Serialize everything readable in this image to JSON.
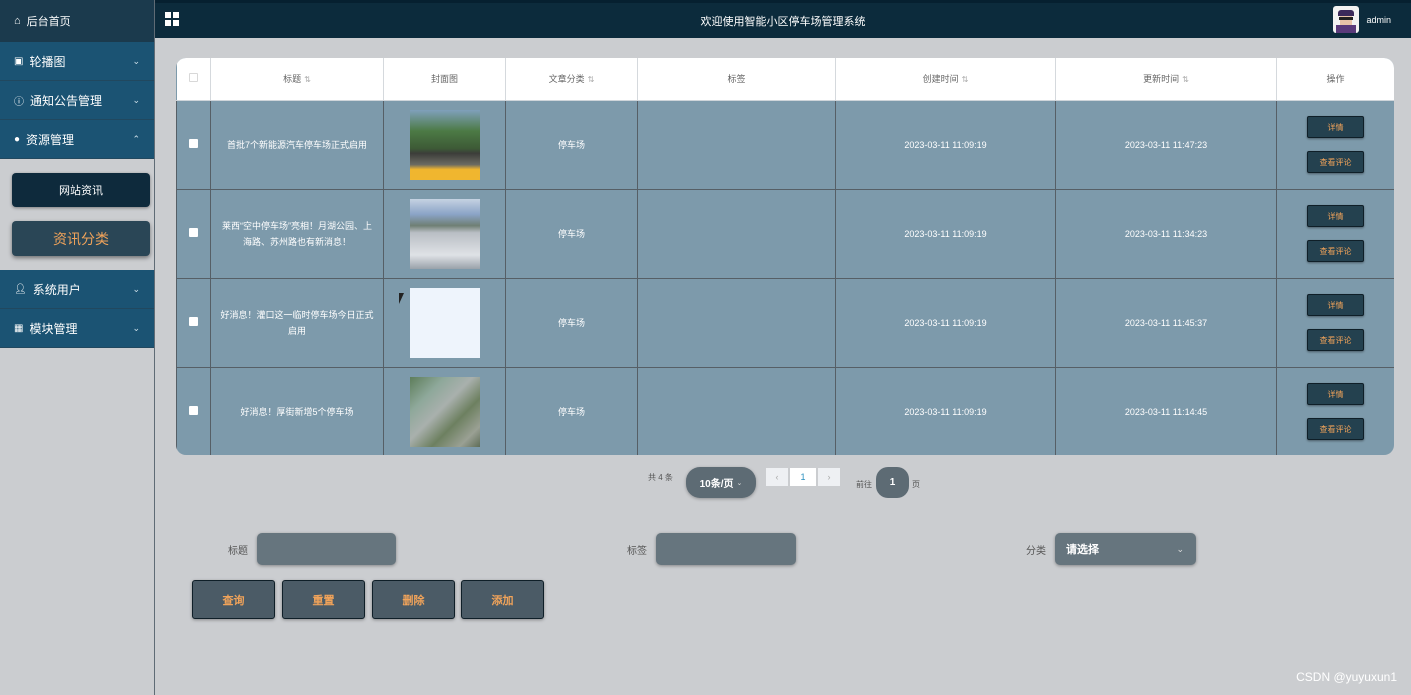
{
  "header": {
    "title": "欢迎使用智能小区停车场管理系统",
    "username": "admin"
  },
  "sidebar": {
    "home": "后台首页",
    "items": [
      {
        "label": "轮播图",
        "icon": "image-icon"
      },
      {
        "label": "通知公告管理",
        "icon": "info-icon"
      },
      {
        "label": "资源管理",
        "icon": "location-pin-icon"
      },
      {
        "label": "系统用户",
        "icon": "user-icon"
      },
      {
        "label": "模块管理",
        "icon": "grid-icon"
      }
    ],
    "sub_items": [
      "网站资讯",
      "资讯分类"
    ]
  },
  "table": {
    "headers": [
      "标题",
      "封面图",
      "文章分类",
      "标签",
      "创建时间",
      "更新时间",
      "操作"
    ],
    "rows": [
      {
        "title": "首批7个新能源汽车停车场正式启用",
        "category": "停车场",
        "tags": "",
        "created": "2023-03-11 11:09:19",
        "updated": "2023-03-11 11:47:23"
      },
      {
        "title": "莱西“空中停车场”亮相！月湖公园、上海路、苏州路也有新消息！",
        "category": "停车场",
        "tags": "",
        "created": "2023-03-11 11:09:19",
        "updated": "2023-03-11 11:34:23"
      },
      {
        "title": "好消息！灌口这一临时停车场今日正式启用",
        "category": "停车场",
        "tags": "",
        "created": "2023-03-11 11:09:19",
        "updated": "2023-03-11 11:45:37"
      },
      {
        "title": "好消息！厚街新增5个停车场",
        "category": "停车场",
        "tags": "",
        "created": "2023-03-11 11:09:19",
        "updated": "2023-03-11 11:14:45"
      }
    ],
    "detail_label": "详情",
    "comments_label": "查看评论"
  },
  "pagination": {
    "total": "共 4 条",
    "page_size": "10条/页",
    "current_page": "1",
    "goto_label": "前往",
    "goto_value": "1",
    "page_suffix": "页"
  },
  "search": {
    "title_label": "标题",
    "tag_label": "标签",
    "category_label": "分类",
    "category_placeholder": "请选择"
  },
  "actions": {
    "query": "查询",
    "reset": "重置",
    "delete": "删除",
    "add": "添加"
  },
  "watermark": "CSDN @yuyuxun1"
}
